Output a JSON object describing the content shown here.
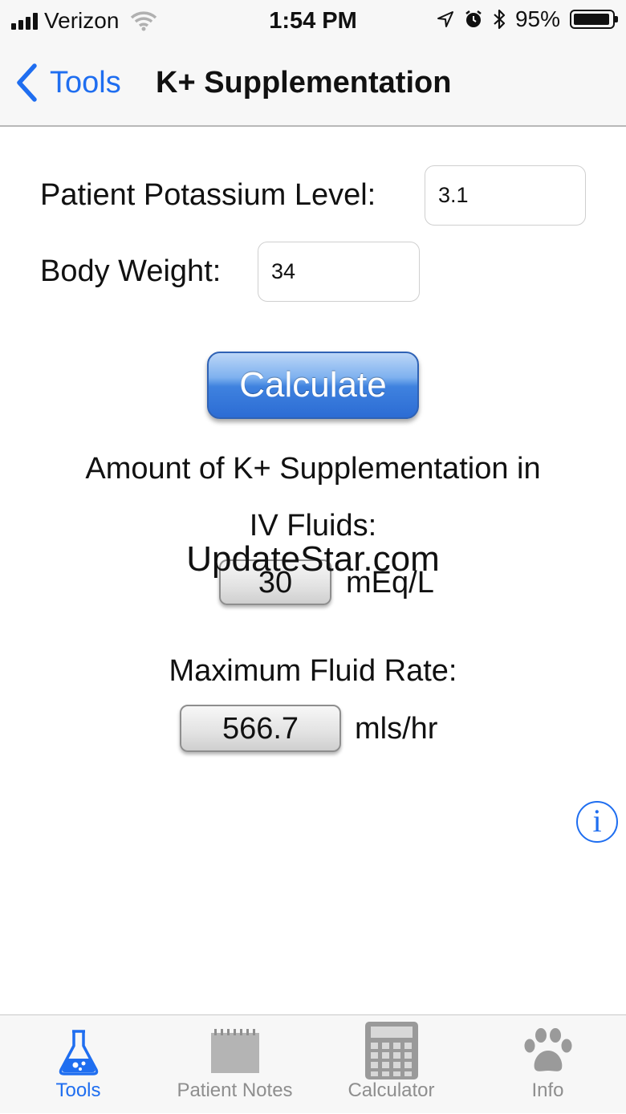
{
  "status_bar": {
    "carrier": "Verizon",
    "time": "1:54 PM",
    "battery_percent": "95%",
    "battery_level": 0.95,
    "icons": [
      "signal-icon",
      "wifi-icon",
      "location-icon",
      "alarm-icon",
      "bluetooth-icon",
      "battery-icon"
    ]
  },
  "nav": {
    "back_label": "Tools",
    "title": "K+ Supplementation"
  },
  "form": {
    "potassium_label": "Patient Potassium Level:",
    "potassium_value": "3.1",
    "weight_label": "Body Weight:",
    "weight_value": "34",
    "calculate_label": "Calculate"
  },
  "results": {
    "supplement_heading_line1": "Amount of K+ Supplementation in",
    "supplement_heading_line2": "IV Fluids:",
    "supplement_value": "30",
    "supplement_unit": "mEq/L",
    "rate_heading": "Maximum Fluid Rate:",
    "rate_value": "566.7",
    "rate_unit": "mls/hr"
  },
  "watermark": "UpdateStar.com",
  "info_button": "i",
  "tabs": [
    {
      "label": "Tools",
      "icon": "flask-icon",
      "active": true
    },
    {
      "label": "Patient Notes",
      "icon": "notepad-icon",
      "active": false
    },
    {
      "label": "Calculator",
      "icon": "calculator-icon",
      "active": false
    },
    {
      "label": "Info",
      "icon": "paw-icon",
      "active": false
    }
  ],
  "colors": {
    "accent": "#1f6ef0",
    "inactive": "#8e8e8e",
    "button_blue": "#3f82df"
  }
}
